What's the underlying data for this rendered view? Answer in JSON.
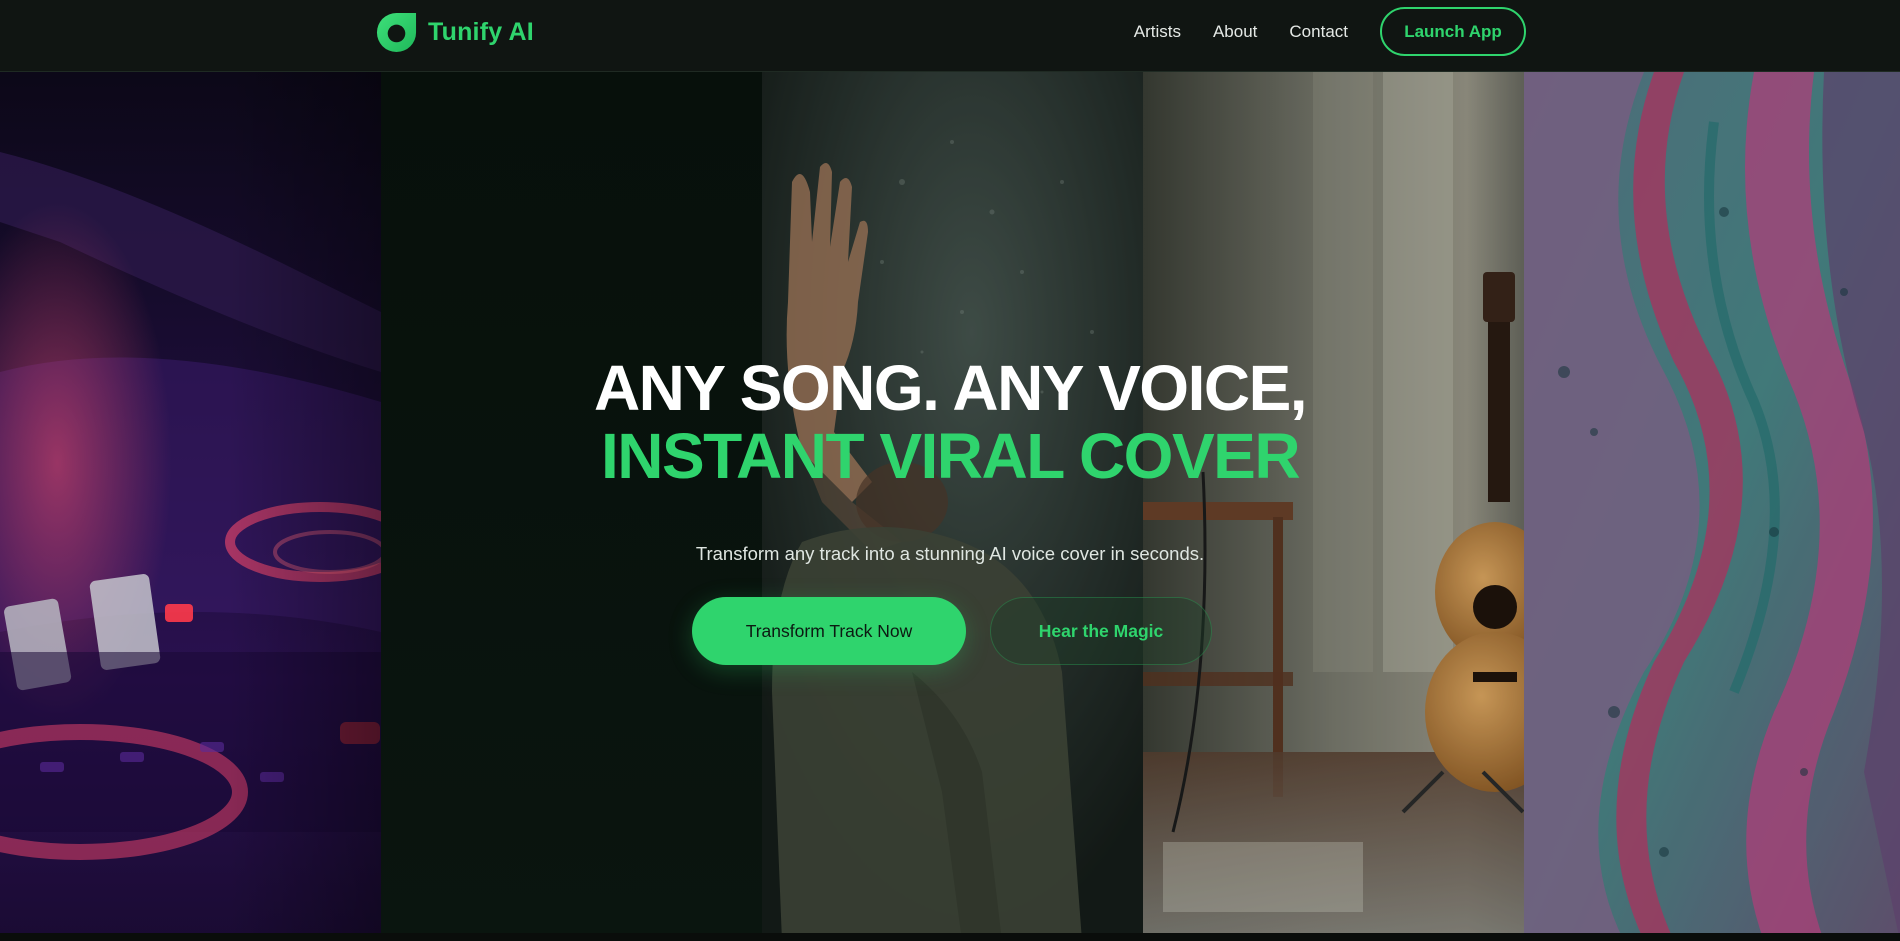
{
  "brand": {
    "name": "Tunify AI",
    "logo_icon": "leaf-ring-logo-icon",
    "accent_color": "#2fd46d"
  },
  "nav": {
    "links": [
      "Artists",
      "About",
      "Contact"
    ],
    "cta_label": "Launch App"
  },
  "hero": {
    "headline_line1": "ANY SONG. ANY VOICE,",
    "headline_line2": "INSTANT VIRAL COVER",
    "subtitle": "Transform any track into a stunning AI voice cover in seconds.",
    "primary_button": "Transform Track Now",
    "secondary_button": "Hear the Magic",
    "background_panels": [
      "dj-mixer-image",
      "dark-panel",
      "performer-raising-hand-image",
      "acoustic-guitar-room-image",
      "fluid-art-image"
    ]
  }
}
